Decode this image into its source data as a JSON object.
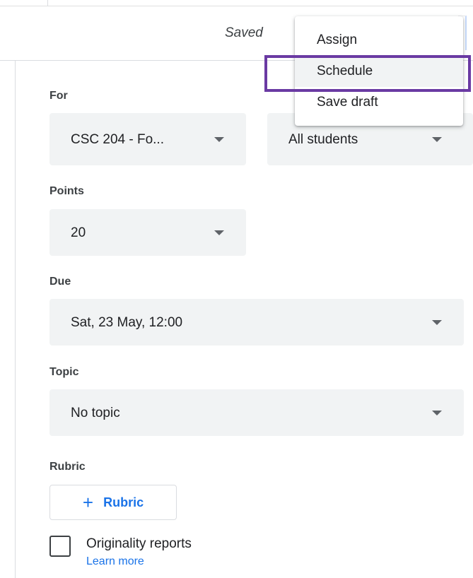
{
  "header": {
    "status": "Saved"
  },
  "menu": {
    "items": [
      {
        "label": "Assign"
      },
      {
        "label": "Schedule"
      },
      {
        "label": "Save draft"
      }
    ],
    "highlighted_index": 1
  },
  "fields": {
    "for_label": "For",
    "class_value": "CSC 204 - Fo...",
    "students_value": "All students",
    "points_label": "Points",
    "points_value": "20",
    "due_label": "Due",
    "due_value": "Sat, 23 May, 12:00",
    "topic_label": "Topic",
    "topic_value": "No topic",
    "rubric_label": "Rubric",
    "rubric_button": "Rubric",
    "originality_label": "Originality reports",
    "learn_more": "Learn more"
  },
  "icons": {
    "plus": "plus-icon",
    "dropdown": "caret-down-icon",
    "checkbox": "checkbox-icon"
  },
  "colors": {
    "accent": "#1a73e8",
    "field_bg": "#f1f3f4",
    "highlight": "#6a3aa3"
  }
}
